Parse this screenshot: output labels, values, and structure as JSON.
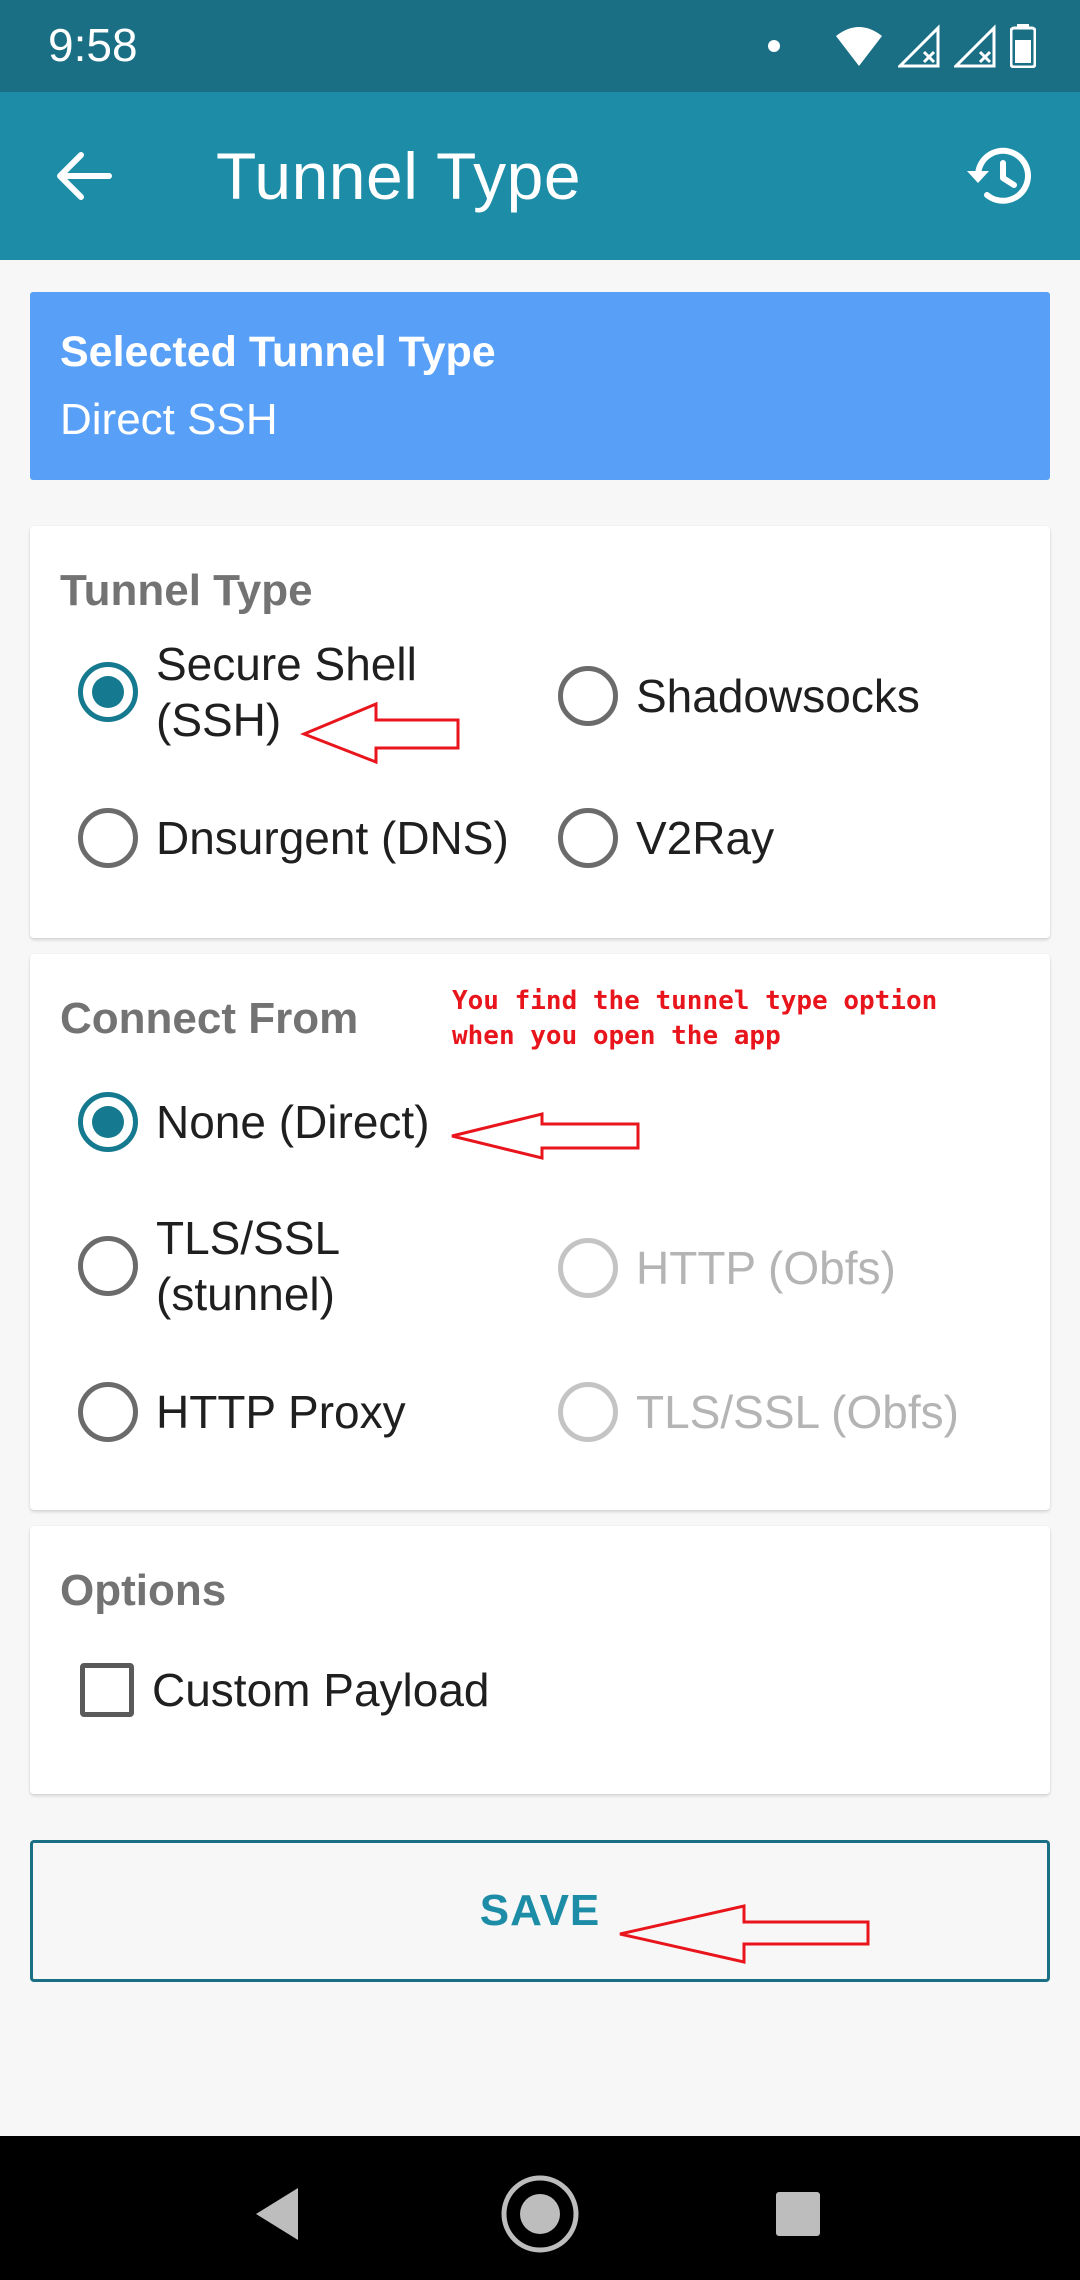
{
  "status_bar": {
    "time": "9:58"
  },
  "app_bar": {
    "title": "Tunnel Type"
  },
  "selected": {
    "label": "Selected Tunnel Type",
    "value": "Direct SSH"
  },
  "tunnel_type": {
    "title": "Tunnel Type",
    "options": [
      {
        "line1": "Secure Shell",
        "line2": "(SSH)",
        "checked": true,
        "disabled": false
      },
      {
        "line1": "Shadowsocks",
        "checked": false,
        "disabled": false
      },
      {
        "line1": "Dnsurgent (DNS)",
        "checked": false,
        "disabled": false
      },
      {
        "line1": "V2Ray",
        "checked": false,
        "disabled": false
      }
    ]
  },
  "connect_from": {
    "title": "Connect From",
    "options": [
      {
        "line1": "None (Direct)",
        "checked": true,
        "disabled": false
      },
      {
        "line1": "TLS/SSL",
        "line2": "(stunnel)",
        "checked": false,
        "disabled": false
      },
      {
        "line1": "HTTP (Obfs)",
        "checked": false,
        "disabled": true
      },
      {
        "line1": "HTTP Proxy",
        "checked": false,
        "disabled": false
      },
      {
        "line1": "TLS/SSL (Obfs)",
        "checked": false,
        "disabled": true
      }
    ]
  },
  "options": {
    "title": "Options",
    "custom_payload": {
      "label": "Custom Payload",
      "checked": false
    }
  },
  "annotation": {
    "line1": "You find the tunnel type option",
    "line2": "when you open the app",
    "color": "#e8161c"
  },
  "save_label": "SAVE",
  "colors": {
    "status_bar": "#1b6f84",
    "app_bar": "#1d8ca6",
    "banner": "#58a0f7",
    "accent": "#157a8f"
  }
}
